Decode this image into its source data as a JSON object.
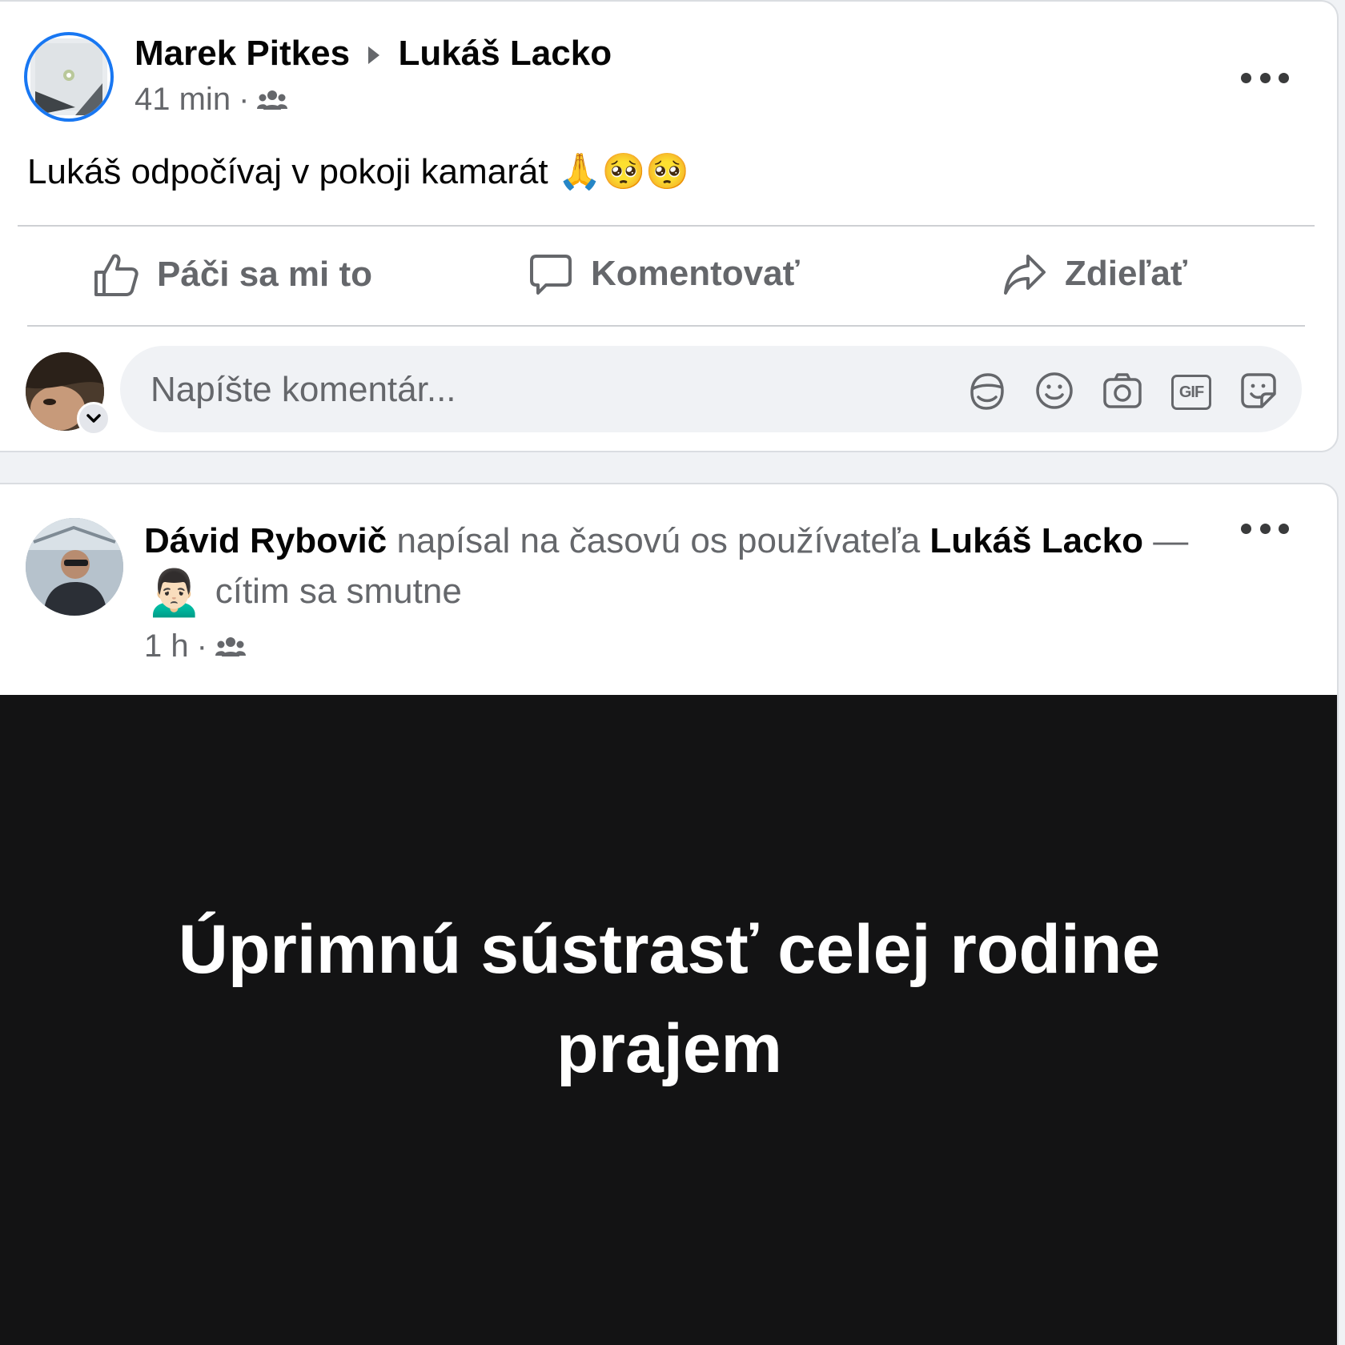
{
  "post1": {
    "author": "Marek Pitkes",
    "target": "Lukáš Lacko",
    "time": "41 min",
    "separator": "·",
    "audience_icon": "friends-icon",
    "text": "Lukáš odpočívaj v pokoji kamarát 🙏🥺🥺",
    "actions": {
      "like": "Páči sa mi to",
      "comment": "Komentovať",
      "share": "Zdieľať"
    },
    "comment_placeholder": "Napíšte komentár...",
    "comment_icons": [
      "avatar-sticker-icon",
      "emoji-icon",
      "camera-icon",
      "gif-icon",
      "sticker-icon"
    ],
    "gif_label": "GIF"
  },
  "post2": {
    "author": "Dávid Rybovič",
    "verb": "napísal na časovú os používateľa",
    "target": "Lukáš Lacko",
    "dash": "—",
    "feeling_emoji": "🙍🏻‍♂️",
    "feeling": "cítim sa smutne",
    "time": "1 h",
    "separator": "·",
    "background_text": "Úprimnú sústrasť celej rodine prajem",
    "background_color": "#131314"
  },
  "colors": {
    "accent": "#1877f2",
    "muted": "#65676b",
    "card": "#ffffff",
    "input_bg": "#f0f2f5"
  }
}
